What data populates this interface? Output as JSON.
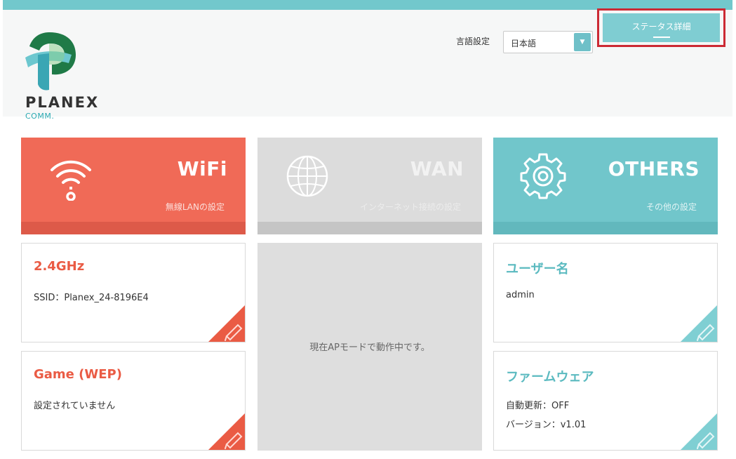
{
  "brand": {
    "name": "PLANEX",
    "sub": "COMM."
  },
  "header": {
    "language_label": "言語設定",
    "language_value": "日本語",
    "status_button": "ステータス詳細"
  },
  "tiles": {
    "wifi": {
      "title": "WiFi",
      "subtitle": "無線LANの設定"
    },
    "wan": {
      "title": "WAN",
      "subtitle": "インターネット接続の設定"
    },
    "others": {
      "title": "OTHERS",
      "subtitle": "その他の設定"
    }
  },
  "cards": {
    "wifi24": {
      "title": "2.4GHz",
      "line1": "SSID：Planex_24-8196E4"
    },
    "game": {
      "title": "Game (WEP)",
      "line1": "設定されていません"
    },
    "wan_message": "現在APモードで動作中です。",
    "user": {
      "title": "ユーザー名",
      "line1": "admin"
    },
    "firmware": {
      "title": "ファームウェア",
      "line1": "自動更新：OFF",
      "line2": "バージョン：v1.01"
    }
  },
  "colors": {
    "accent_teal": "#72c8cc",
    "wifi_red": "#f06a57",
    "wan_gray": "#dcdcdc",
    "highlight_red": "#cc2a34"
  },
  "icons": {
    "wifi": "wifi-icon",
    "wan": "globe-icon",
    "others": "gear-icon",
    "edit": "pencil-icon",
    "dropdown": "chevron-down-icon"
  }
}
